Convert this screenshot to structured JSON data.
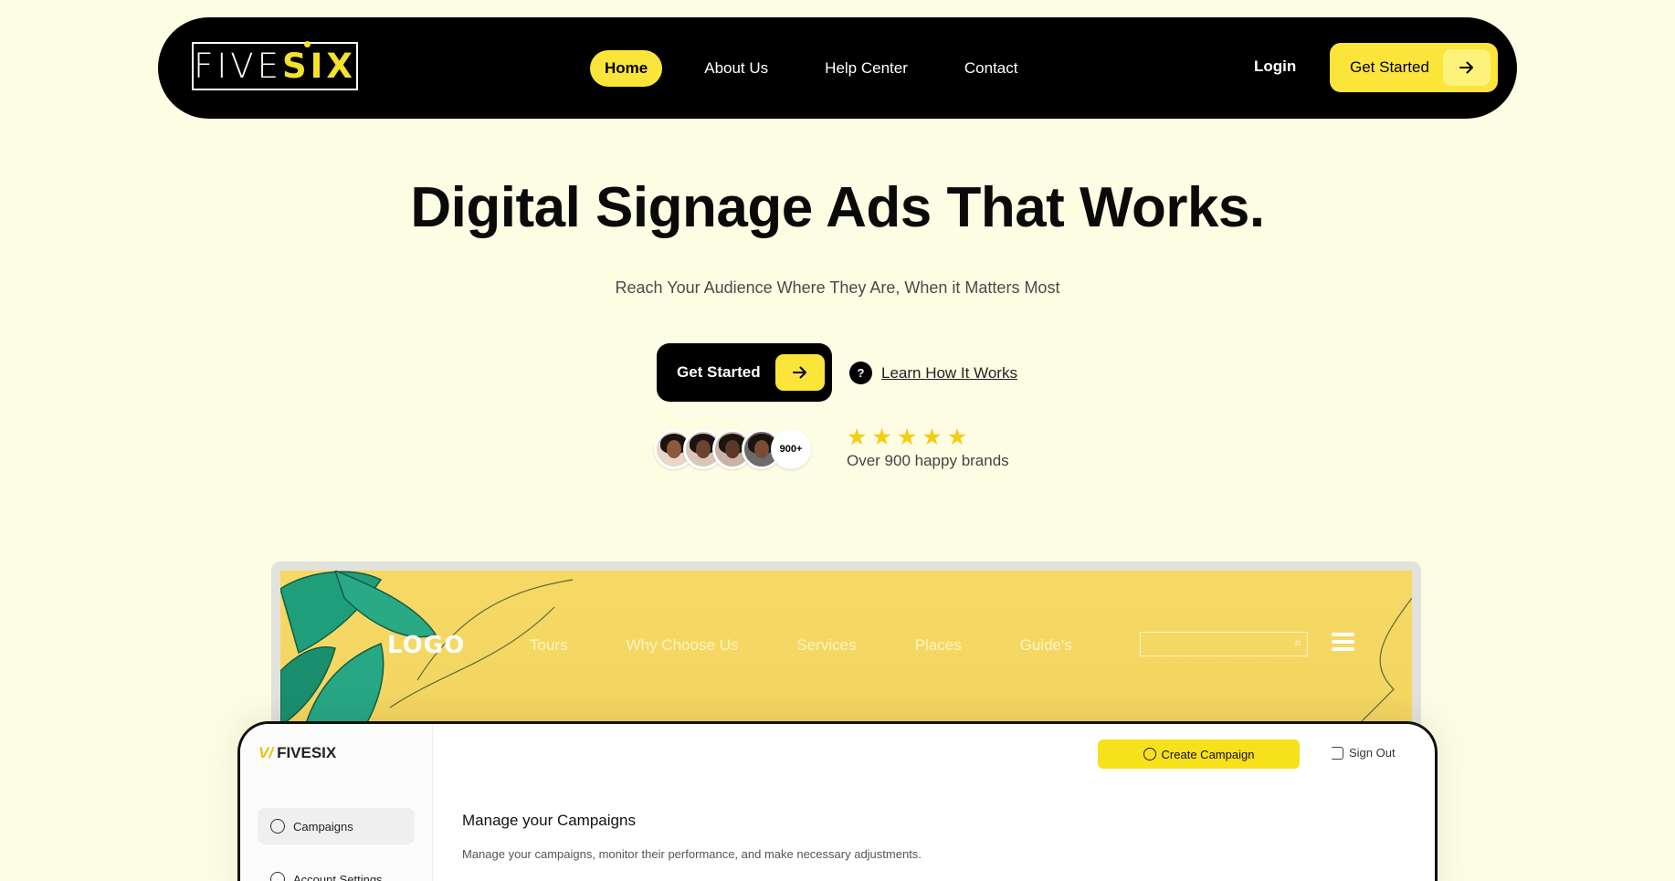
{
  "nav": {
    "logo_left": "FIVE",
    "logo_right": "SIX",
    "links": [
      "Home",
      "About Us",
      "Help Center",
      "Contact"
    ],
    "login": "Login",
    "cta": "Get Started"
  },
  "hero": {
    "title": "Digital Signage Ads That Works.",
    "subtitle": "Reach Your Audience Where They Are, When it Matters Most",
    "cta": "Get Started",
    "learn": "Learn How It Works",
    "learn_icon": "?",
    "avatar_count": "900+",
    "stars": 5,
    "rating_text": "Over 900 happy brands"
  },
  "preview_site": {
    "logo": "LOGO",
    "links": [
      "Tours",
      "Why Choose Us",
      "Services",
      "Places",
      "Guide's"
    ]
  },
  "app": {
    "logo": "FIVESIX",
    "logo_mark": "V/",
    "sidebar": [
      "Campaigns",
      "Account Settings"
    ],
    "create": "Create Campaign",
    "signout": "Sign Out",
    "heading": "Manage your Campaigns",
    "description": "Manage your campaigns, monitor their performance, and make necessary adjustments."
  },
  "colors": {
    "background": "#fdfde3",
    "accent": "#fbe53a",
    "nav": "#000000"
  }
}
